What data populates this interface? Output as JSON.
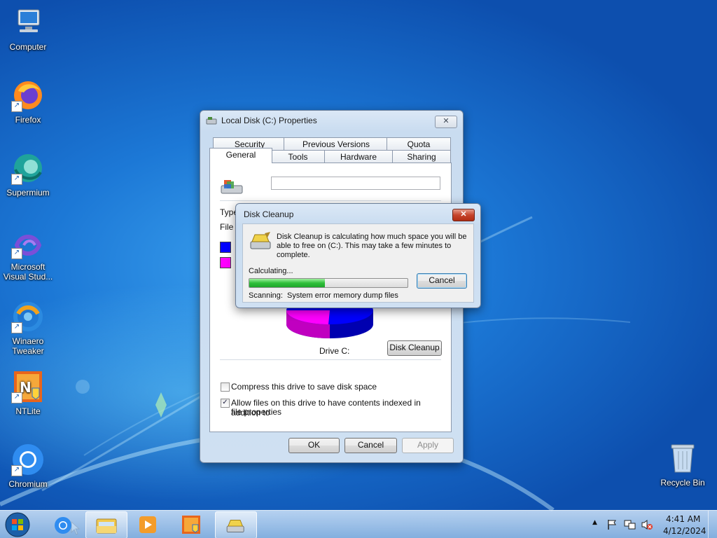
{
  "desktop": {
    "icons": [
      {
        "label": "Computer"
      },
      {
        "label": "Firefox"
      },
      {
        "label": "Supermium"
      },
      {
        "label": "Microsoft Visual Stud..."
      },
      {
        "label": "Winaero Tweaker"
      },
      {
        "label": "NTLite"
      },
      {
        "label": "Chromium"
      },
      {
        "label": "Recycle Bin"
      }
    ]
  },
  "properties_window": {
    "title": "Local Disk (C:) Properties",
    "close_label": "✕",
    "tabs_row1": [
      "Security",
      "Previous Versions",
      "Quota"
    ],
    "tabs_row2": [
      "General",
      "Tools",
      "Hardware",
      "Sharing"
    ],
    "name_value": "",
    "type_label_partial": "Type",
    "file_label_partial": "File s",
    "chart_colors": {
      "used": "#0000ff",
      "free": "#ff00ff"
    },
    "drive_label": "Drive C:",
    "disk_cleanup_button": "Disk Cleanup",
    "compress_label": "Compress this drive to save disk space",
    "compress_checked": false,
    "index_label_line1": "Allow files on this drive to have contents indexed in addition to",
    "index_label_line2": "file properties",
    "index_checked": true,
    "ok_label": "OK",
    "cancel_label": "Cancel",
    "apply_label": "Apply"
  },
  "cleanup_dialog": {
    "title": "Disk Cleanup",
    "close_label": "✕",
    "message_line1": "Disk Cleanup is calculating how much space you will be",
    "message_line2": "able to free on  (C:). This may take a few minutes to",
    "message_line3": "complete.",
    "status_label": "Calculating...",
    "progress": 0.48,
    "cancel_label": "Cancel",
    "scanning_label": "Scanning:",
    "scanning_item": "System error memory dump files"
  },
  "taskbar": {
    "time": "4:41 AM",
    "date": "4/12/2024",
    "show_hidden_icons": "▲"
  }
}
